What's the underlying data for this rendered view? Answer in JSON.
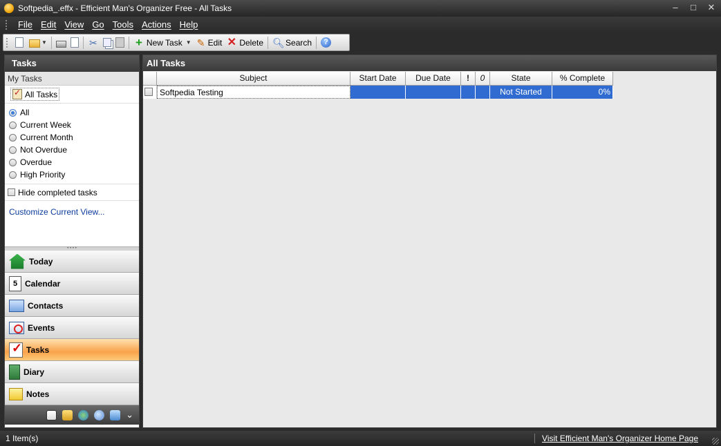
{
  "window": {
    "title": "Softpedia_.effx - Efficient Man's Organizer Free - All Tasks",
    "minimize": "–",
    "maximize": "□",
    "close": "✕"
  },
  "menu": [
    "File",
    "Edit",
    "View",
    "Go",
    "Tools",
    "Actions",
    "Help"
  ],
  "toolbar": {
    "new_task": "New Task",
    "edit": "Edit",
    "delete": "Delete",
    "search": "Search"
  },
  "left_panel": {
    "header": "Tasks",
    "section_label": "My Tasks",
    "selected_view": "All Tasks",
    "filters": [
      {
        "label": "All",
        "checked": true
      },
      {
        "label": "Current Week",
        "checked": false
      },
      {
        "label": "Current Month",
        "checked": false
      },
      {
        "label": "Not Overdue",
        "checked": false
      },
      {
        "label": "Overdue",
        "checked": false
      },
      {
        "label": "High Priority",
        "checked": false
      }
    ],
    "hide_completed": "Hide completed tasks",
    "customize_link": "Customize Current View...",
    "nav": [
      {
        "label": "Today",
        "icon": "home-icon"
      },
      {
        "label": "Calendar",
        "icon": "calendar-icon",
        "glyph": "5"
      },
      {
        "label": "Contacts",
        "icon": "contacts-icon"
      },
      {
        "label": "Events",
        "icon": "events-icon"
      },
      {
        "label": "Tasks",
        "icon": "tasks-icon",
        "active": true
      },
      {
        "label": "Diary",
        "icon": "diary-icon"
      },
      {
        "label": "Notes",
        "icon": "notes-icon"
      }
    ],
    "footer_more": "⌄"
  },
  "main": {
    "header": "All Tasks",
    "columns": [
      "",
      "Subject",
      "Start Date",
      "Due Date",
      "!",
      "0",
      "State",
      "% Complete"
    ],
    "rows": [
      {
        "subject": "Softpedia Testing",
        "start": "",
        "due": "",
        "priority": "",
        "attach": "",
        "state": "Not Started",
        "complete": "0%"
      }
    ]
  },
  "status": {
    "items": "1 Item(s)",
    "home_link": "Visit Efficient Man's Organizer Home Page"
  },
  "colors": {
    "selection": "#2f6bd1",
    "active_nav": "#f9a24a",
    "chrome_dark": "#2b2b2b"
  }
}
